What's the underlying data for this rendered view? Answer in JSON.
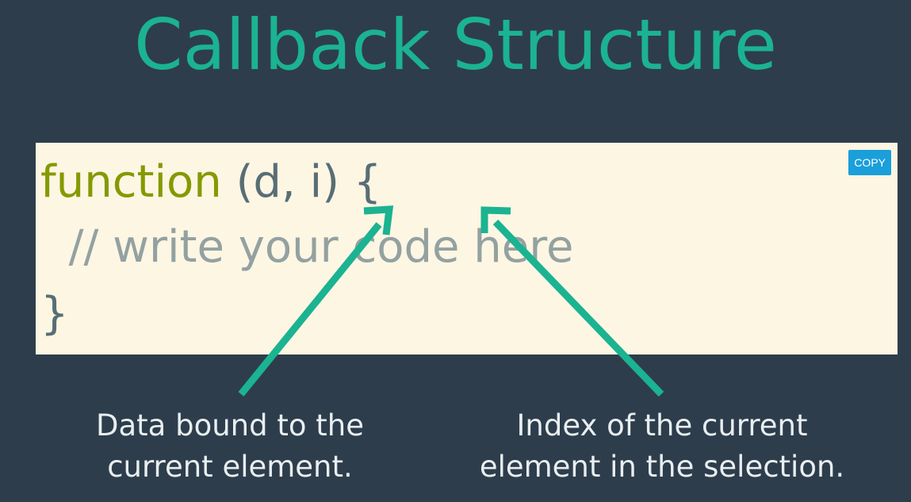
{
  "slide": {
    "title": "Callback Structure"
  },
  "code": {
    "line1_keyword": "function",
    "line1_rest": " (d, i) {",
    "line2_comment": "  // write your code here",
    "line3_brace": "}",
    "copy_label": "COPY"
  },
  "captions": {
    "left_line1": "Data bound to the",
    "left_line2": "current element.",
    "right_line1": "Index of the current",
    "right_line2": "element in the selection."
  },
  "colors": {
    "background": "#2e3d4b",
    "accent": "#1bb391",
    "code_background": "#fdf6e3",
    "keyword": "#859900",
    "punctuation": "#586e75",
    "comment": "#93a1a1",
    "copy_button": "#1a9fdb"
  }
}
